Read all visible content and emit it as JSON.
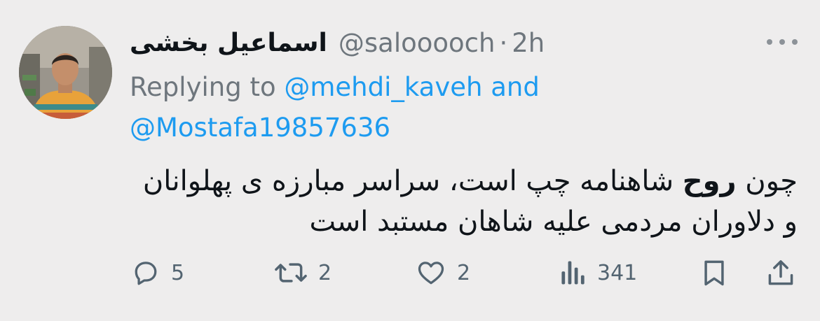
{
  "tweet": {
    "display_name": "اسماعیل بخشی",
    "handle": "@salooooch",
    "separator": "·",
    "time": "2h",
    "replying_prefix": "Replying to",
    "reply_to_1": "@mehdi_kaveh",
    "reply_and": "and",
    "reply_to_2": "@Mostafa19857636",
    "body_part1": "چون ",
    "body_bold": "روح",
    "body_part2": " شاهنامه چپ است، سراسر مبارزه ی پهلوانان و دلاوران مردمی علیه شاهان مستبد است"
  },
  "actions": {
    "replies": "5",
    "retweets": "2",
    "likes": "2",
    "views": "341"
  },
  "icons": {
    "more": "more-horizontal-icon",
    "reply": "reply-icon",
    "retweet": "retweet-icon",
    "like": "heart-icon",
    "views": "views-bar-chart-icon",
    "bookmark": "bookmark-icon",
    "share": "share-icon"
  },
  "colors": {
    "background": "#eeeded",
    "text": "#0f1419",
    "muted": "#6e767d",
    "link": "#1d9bf0",
    "icon": "#536471"
  }
}
